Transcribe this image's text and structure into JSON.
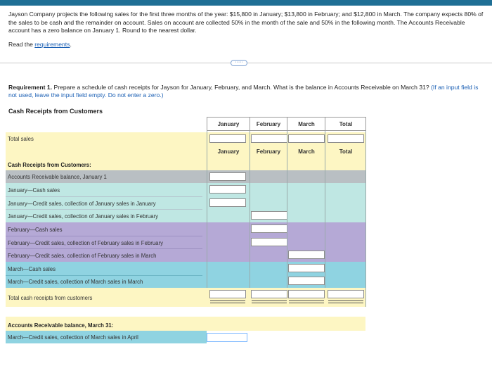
{
  "problem": {
    "intro": "Jayson Company projects the following sales for the first three months of the year: $15,800 in January; $13,800 in February; and $12,800 in March. The company expects 80% of the sales to be cash and the remainder on account. Sales on account are collected 50% in the month of the sale and 50% in the following month. The Accounts Receivable account has a zero balance on January 1. Round to the nearest dollar.",
    "read_prefix": "Read the ",
    "read_link": "requirements",
    "read_suffix": ".",
    "more_button": "·····"
  },
  "requirement": {
    "bold": "Requirement 1.",
    "text": " Prepare a schedule of cash receipts for Jayson for January, February, and March. What is the balance in Accounts Receivable on March 31?",
    "hint": " (If an input field is not used, leave the input field empty. Do not enter a zero.)"
  },
  "schedule": {
    "title": "Cash Receipts from Customers",
    "columns": [
      "January",
      "February",
      "March",
      "Total"
    ],
    "total_sales_label": "Total sales",
    "cash_receipts_header": "Cash Receipts from Customers:",
    "rows": [
      "Accounts Receivable balance, January 1",
      "January—Cash sales",
      "January—Credit sales, collection of January sales in January",
      "January—Credit sales, collection of January sales in February",
      "February—Cash sales",
      "February—Credit sales, collection of February sales in February",
      "February—Credit sales, collection of February sales in March",
      "March—Cash sales",
      "March—Credit sales, collection of March sales in March"
    ],
    "total_label": "Total cash receipts from customers",
    "ar_header": "Accounts Receivable balance, March 31:",
    "ar_row": "March—Credit sales, collection of March sales in April"
  },
  "colors": {
    "header_bar": "#1f6f95",
    "yellow": "#fdf6c3",
    "gray": "#b9bfc3",
    "teal": "#bfe7e3",
    "purple": "#b5a9d6",
    "cyan": "#8fd3e1",
    "link": "#1a5fb4"
  }
}
